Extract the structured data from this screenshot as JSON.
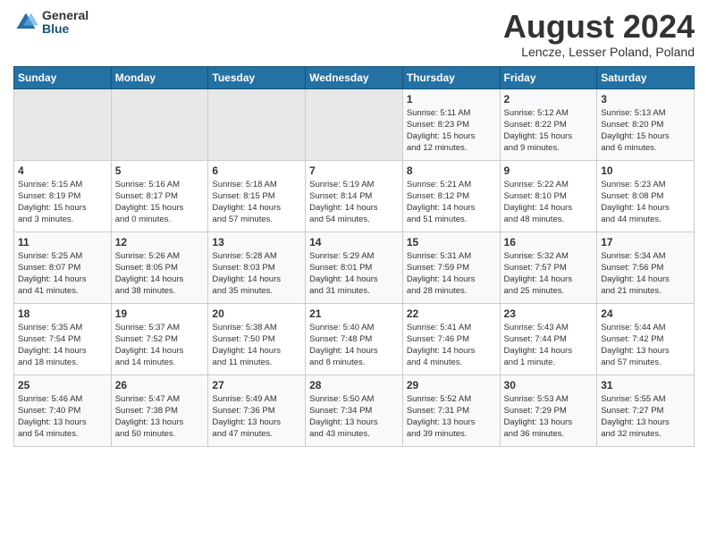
{
  "logo": {
    "general": "General",
    "blue": "Blue"
  },
  "header": {
    "month": "August 2024",
    "location": "Lencze, Lesser Poland, Poland"
  },
  "days_of_week": [
    "Sunday",
    "Monday",
    "Tuesday",
    "Wednesday",
    "Thursday",
    "Friday",
    "Saturday"
  ],
  "weeks": [
    [
      {
        "day": "",
        "info": ""
      },
      {
        "day": "",
        "info": ""
      },
      {
        "day": "",
        "info": ""
      },
      {
        "day": "",
        "info": ""
      },
      {
        "day": "1",
        "info": "Sunrise: 5:11 AM\nSunset: 8:23 PM\nDaylight: 15 hours\nand 12 minutes."
      },
      {
        "day": "2",
        "info": "Sunrise: 5:12 AM\nSunset: 8:22 PM\nDaylight: 15 hours\nand 9 minutes."
      },
      {
        "day": "3",
        "info": "Sunrise: 5:13 AM\nSunset: 8:20 PM\nDaylight: 15 hours\nand 6 minutes."
      }
    ],
    [
      {
        "day": "4",
        "info": "Sunrise: 5:15 AM\nSunset: 8:19 PM\nDaylight: 15 hours\nand 3 minutes."
      },
      {
        "day": "5",
        "info": "Sunrise: 5:16 AM\nSunset: 8:17 PM\nDaylight: 15 hours\nand 0 minutes."
      },
      {
        "day": "6",
        "info": "Sunrise: 5:18 AM\nSunset: 8:15 PM\nDaylight: 14 hours\nand 57 minutes."
      },
      {
        "day": "7",
        "info": "Sunrise: 5:19 AM\nSunset: 8:14 PM\nDaylight: 14 hours\nand 54 minutes."
      },
      {
        "day": "8",
        "info": "Sunrise: 5:21 AM\nSunset: 8:12 PM\nDaylight: 14 hours\nand 51 minutes."
      },
      {
        "day": "9",
        "info": "Sunrise: 5:22 AM\nSunset: 8:10 PM\nDaylight: 14 hours\nand 48 minutes."
      },
      {
        "day": "10",
        "info": "Sunrise: 5:23 AM\nSunset: 8:08 PM\nDaylight: 14 hours\nand 44 minutes."
      }
    ],
    [
      {
        "day": "11",
        "info": "Sunrise: 5:25 AM\nSunset: 8:07 PM\nDaylight: 14 hours\nand 41 minutes."
      },
      {
        "day": "12",
        "info": "Sunrise: 5:26 AM\nSunset: 8:05 PM\nDaylight: 14 hours\nand 38 minutes."
      },
      {
        "day": "13",
        "info": "Sunrise: 5:28 AM\nSunset: 8:03 PM\nDaylight: 14 hours\nand 35 minutes."
      },
      {
        "day": "14",
        "info": "Sunrise: 5:29 AM\nSunset: 8:01 PM\nDaylight: 14 hours\nand 31 minutes."
      },
      {
        "day": "15",
        "info": "Sunrise: 5:31 AM\nSunset: 7:59 PM\nDaylight: 14 hours\nand 28 minutes."
      },
      {
        "day": "16",
        "info": "Sunrise: 5:32 AM\nSunset: 7:57 PM\nDaylight: 14 hours\nand 25 minutes."
      },
      {
        "day": "17",
        "info": "Sunrise: 5:34 AM\nSunset: 7:56 PM\nDaylight: 14 hours\nand 21 minutes."
      }
    ],
    [
      {
        "day": "18",
        "info": "Sunrise: 5:35 AM\nSunset: 7:54 PM\nDaylight: 14 hours\nand 18 minutes."
      },
      {
        "day": "19",
        "info": "Sunrise: 5:37 AM\nSunset: 7:52 PM\nDaylight: 14 hours\nand 14 minutes."
      },
      {
        "day": "20",
        "info": "Sunrise: 5:38 AM\nSunset: 7:50 PM\nDaylight: 14 hours\nand 11 minutes."
      },
      {
        "day": "21",
        "info": "Sunrise: 5:40 AM\nSunset: 7:48 PM\nDaylight: 14 hours\nand 8 minutes."
      },
      {
        "day": "22",
        "info": "Sunrise: 5:41 AM\nSunset: 7:46 PM\nDaylight: 14 hours\nand 4 minutes."
      },
      {
        "day": "23",
        "info": "Sunrise: 5:43 AM\nSunset: 7:44 PM\nDaylight: 14 hours\nand 1 minute."
      },
      {
        "day": "24",
        "info": "Sunrise: 5:44 AM\nSunset: 7:42 PM\nDaylight: 13 hours\nand 57 minutes."
      }
    ],
    [
      {
        "day": "25",
        "info": "Sunrise: 5:46 AM\nSunset: 7:40 PM\nDaylight: 13 hours\nand 54 minutes."
      },
      {
        "day": "26",
        "info": "Sunrise: 5:47 AM\nSunset: 7:38 PM\nDaylight: 13 hours\nand 50 minutes."
      },
      {
        "day": "27",
        "info": "Sunrise: 5:49 AM\nSunset: 7:36 PM\nDaylight: 13 hours\nand 47 minutes."
      },
      {
        "day": "28",
        "info": "Sunrise: 5:50 AM\nSunset: 7:34 PM\nDaylight: 13 hours\nand 43 minutes."
      },
      {
        "day": "29",
        "info": "Sunrise: 5:52 AM\nSunset: 7:31 PM\nDaylight: 13 hours\nand 39 minutes."
      },
      {
        "day": "30",
        "info": "Sunrise: 5:53 AM\nSunset: 7:29 PM\nDaylight: 13 hours\nand 36 minutes."
      },
      {
        "day": "31",
        "info": "Sunrise: 5:55 AM\nSunset: 7:27 PM\nDaylight: 13 hours\nand 32 minutes."
      }
    ]
  ]
}
